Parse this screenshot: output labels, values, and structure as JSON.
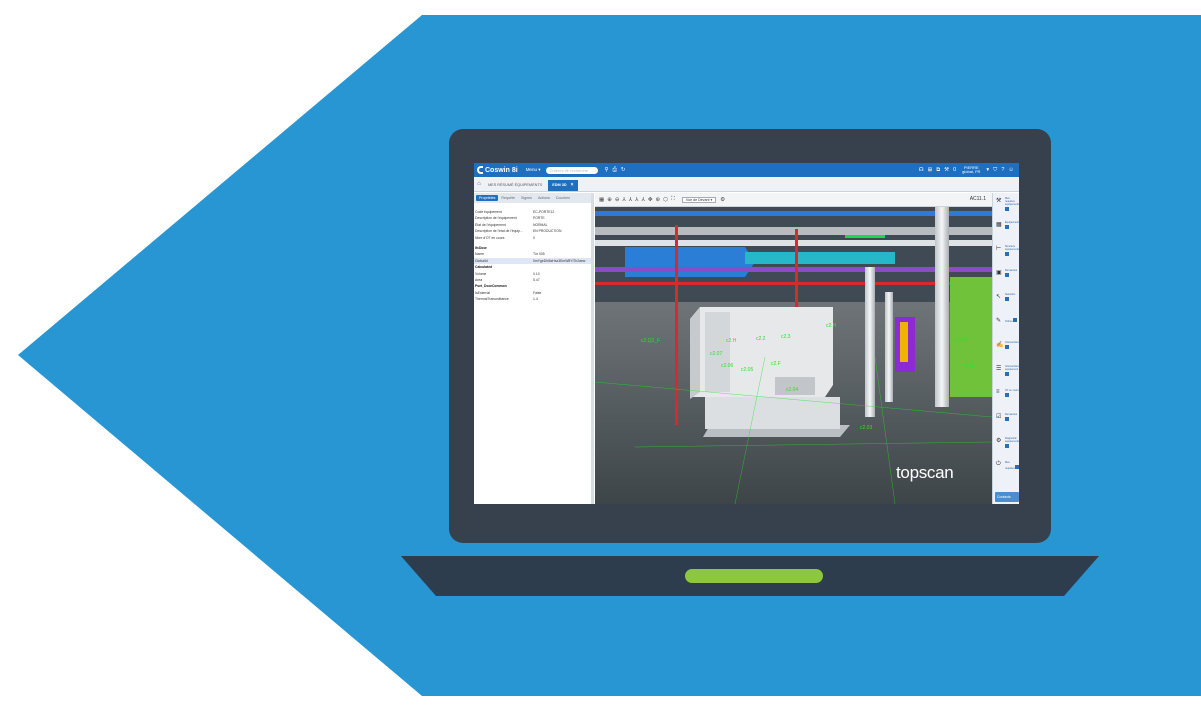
{
  "app": {
    "brand": "Coswin 8i",
    "menu_label": "Menu",
    "search_placeholder": "Critères de recherche",
    "user_name": "PIERRE",
    "user_sub": "global, FR",
    "notifications_count": "0"
  },
  "tabs": [
    {
      "label": "MES RÉSUMÉ ÉQUIPEMENTS",
      "active": false
    },
    {
      "label": "EDM 3D",
      "active": true
    }
  ],
  "subtabs": [
    {
      "label": "Propriétés",
      "active": true
    },
    {
      "label": "Requête",
      "active": false
    },
    {
      "label": "Signes",
      "active": false
    },
    {
      "label": "Actions",
      "active": false
    },
    {
      "label": "Couches",
      "active": false
    }
  ],
  "properties": [
    {
      "key": "Code équipement",
      "value": "EC-PORTE12",
      "type": "row"
    },
    {
      "key": "Description de l'équipement",
      "value": "PORTE",
      "type": "row"
    },
    {
      "key": "État de l'équipement",
      "value": "NORMAL",
      "type": "row"
    },
    {
      "key": "Description de l'état de l'équip...",
      "value": "EN PRODUCTION",
      "type": "row"
    },
    {
      "key": "Nbre d'OT en cours",
      "value": "0",
      "type": "row"
    },
    {
      "key": "",
      "value": "",
      "type": "gap"
    },
    {
      "key": "IfcDoor",
      "value": "",
      "type": "section"
    },
    {
      "key": "Name",
      "value": "Tür 005",
      "type": "row"
    },
    {
      "key": "GlobalId",
      "value": "0mYgeDhl6zHsz3EmW8YlTh2aew",
      "type": "selected"
    },
    {
      "key": "Calculated",
      "value": "",
      "type": "section"
    },
    {
      "key": "Volume",
      "value": "0.10",
      "type": "row"
    },
    {
      "key": "Area",
      "value": "5.47",
      "type": "row"
    },
    {
      "key": "Pset_DoorCommon",
      "value": "",
      "type": "section"
    },
    {
      "key": "IsExternal",
      "value": "False",
      "type": "row"
    },
    {
      "key": "ThermalTransmittance",
      "value": "1.4",
      "type": "row"
    }
  ],
  "viewer": {
    "view_select": "Vue de Devant",
    "view_label": "AC11.1",
    "watermark": "topscan",
    "labels": [
      {
        "text": "c2.Q2_F"
      },
      {
        "text": "c2.H"
      },
      {
        "text": "c2.2"
      },
      {
        "text": "c2.3"
      },
      {
        "text": "c2.07"
      },
      {
        "text": "c2.06"
      },
      {
        "text": "c2.05"
      },
      {
        "text": "c2.F"
      },
      {
        "text": "c2.04"
      },
      {
        "text": "c2.03"
      },
      {
        "text": "c2.09"
      },
      {
        "text": "c2.H"
      },
      {
        "text": "c2.G"
      }
    ]
  },
  "right_panel": {
    "contact_label": "Contacts",
    "items": [
      {
        "icon": "wrench-list-icon",
        "text": "Mes requêtes équipements"
      },
      {
        "icon": "grid-icon",
        "text": "Équipements"
      },
      {
        "icon": "tree-icon",
        "text": "Structure équipements"
      },
      {
        "icon": "calendar-icon",
        "text": "Demandes"
      },
      {
        "icon": "cursor-icon",
        "text": "Sélection"
      },
      {
        "icon": "pen-icon",
        "text": "Ordres"
      },
      {
        "icon": "pencil-box-icon",
        "text": "Interventions"
      },
      {
        "icon": "panel-icon",
        "text": "Interventions équipement"
      },
      {
        "icon": "list-edit-icon",
        "text": "OT en cours"
      },
      {
        "icon": "calendar-check-icon",
        "text": "Demandes"
      },
      {
        "icon": "wrench-alt-icon",
        "text": "Diagnostic équipements"
      },
      {
        "icon": "plug-icon",
        "text": "Mes requêtes"
      }
    ]
  },
  "colors": {
    "background_blue": "#2896d3",
    "laptop_body": "#2d3d4d",
    "laptop_bezel": "#36414d",
    "indicator_green": "#8dc63f",
    "app_blue": "#1e6fc0",
    "label_green": "#2de02d"
  }
}
